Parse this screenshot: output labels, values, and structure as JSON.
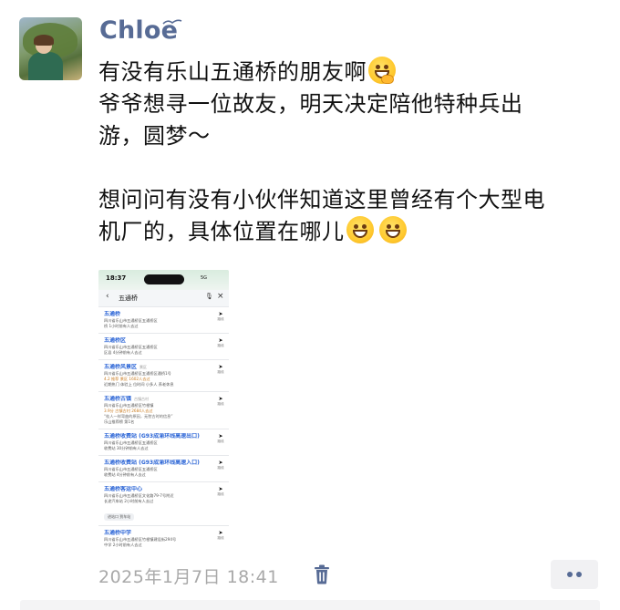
{
  "user": {
    "name": "Chloe"
  },
  "post": {
    "lines": [
      "有没有乐山五通桥的朋友啊",
      "爷爷想寻一位故友，明天决定陪他特种兵出",
      "游，圆梦～",
      "想问问有没有小伙伴知道这里曾经有个大型电",
      "机厂的，具体位置在哪儿"
    ],
    "emojis": [
      "hand-over-mouth-emoji",
      "grin-emoji",
      "grin-emoji"
    ]
  },
  "screenshot": {
    "time": "18:37",
    "signal": "5G",
    "query": "五通桥",
    "nav_label": "路线",
    "results": [
      {
        "title": "五通桥",
        "detail": "四川省乐山市五通桥区五通桥区",
        "extra": "桥 1小时前有人去过"
      },
      {
        "title": "五通桥区",
        "detail": "四川省乐山市五通桥区五通桥区",
        "extra": "区县 4分钟前有人去过"
      },
      {
        "title": "五通桥风景区",
        "tag": "景区",
        "detail": "四川省乐山市五通桥区五通桥区通桥1号",
        "rating": "4.2 推荐  景区 1602人去过",
        "extra": "近期热门 体验上 位时间 小多人 养老休息"
      },
      {
        "title": "五通桥古镇",
        "tag": "古镇古村",
        "detail": "四川省乐山市五通桥区竹根镇",
        "rating": "3.9分 古镇古村 2684人去过",
        "quote": "“桂人一样弯曲的原因，无愁古时的信息”",
        "extra": "乐山推荐榜 第1名"
      },
      {
        "title": "五通桥收费站 (G93成渝环线高速出口)",
        "detail": "四川省乐山市五通桥区五通桥区",
        "extra": "收费站 30分钟前有人去过"
      },
      {
        "title": "五通桥收费站 (G93成渝环线高速入口)",
        "detail": "四川省乐山市五通桥区五通桥区",
        "extra": "收费站 4分钟前有人去过"
      },
      {
        "title": "五通桥客运中心",
        "detail": "四川省乐山市五通桥区文化路79-7号附近",
        "extra": "长途汽车站 2小时前有人去过",
        "chip": "进站口 到车站"
      },
      {
        "title": "五通桥中学",
        "detail": "四川省乐山市五通桥区竹根镇建设街294号",
        "extra": "中学 2小时前有人去过"
      }
    ]
  },
  "meta": {
    "timestamp": "2025年1月7日 18:41"
  },
  "icons": {
    "delete": "trash-icon",
    "more": "more-options-icon"
  },
  "colors": {
    "name": "#576b95",
    "timestamp": "#a9a9a9",
    "link": "#2a64d6"
  }
}
